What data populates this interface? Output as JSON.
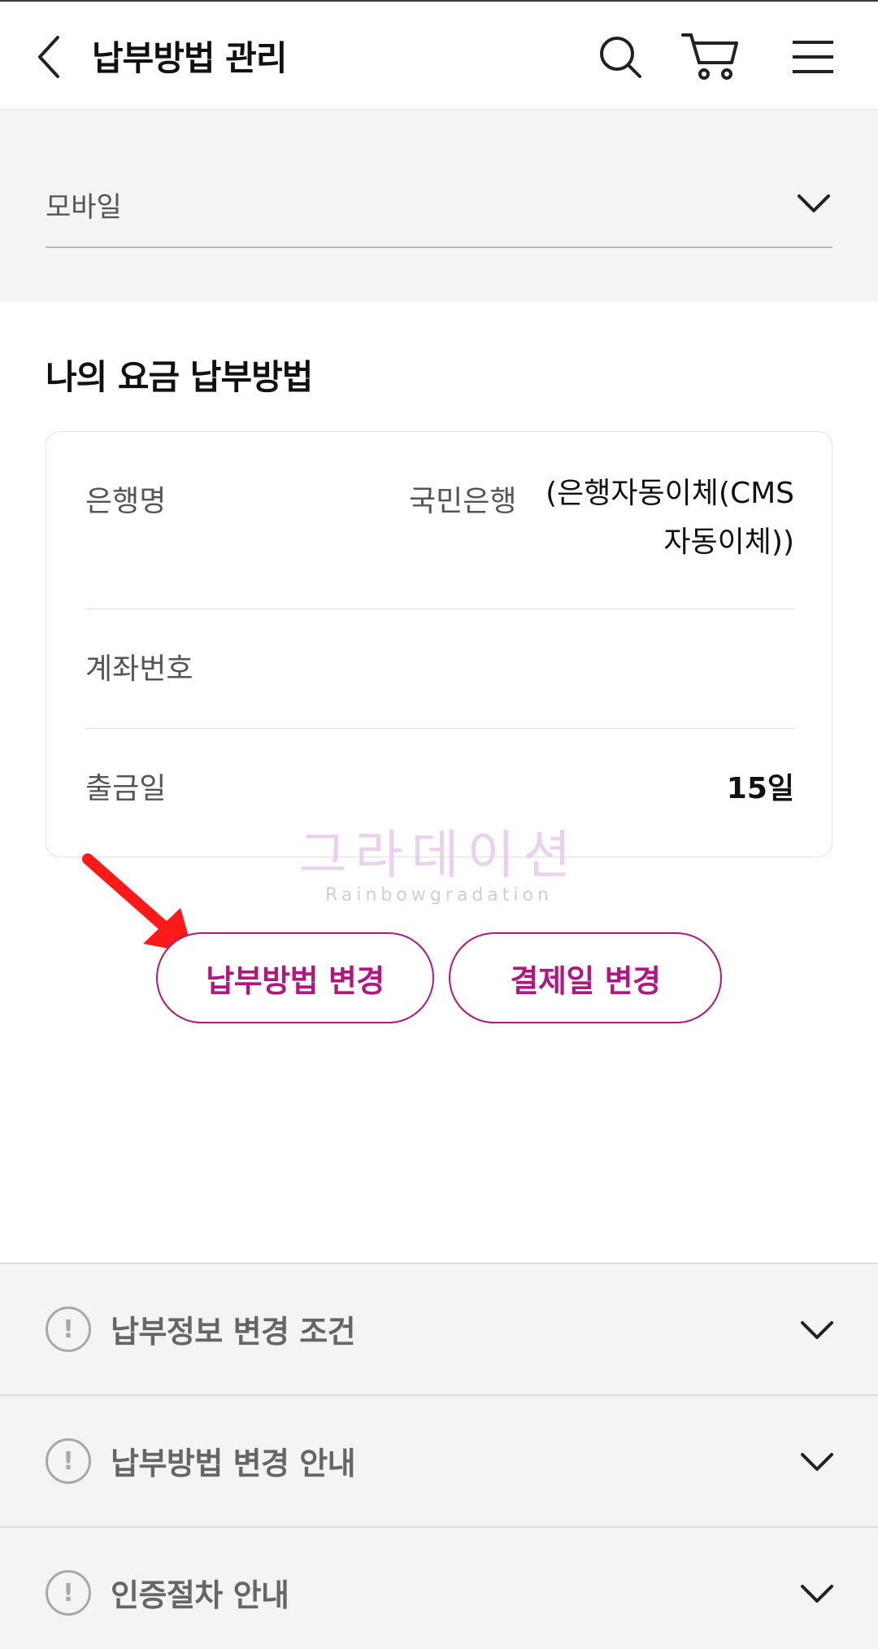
{
  "header": {
    "title": "납부방법 관리",
    "icons": [
      "back-icon",
      "search-icon",
      "cart-icon",
      "menu-icon"
    ]
  },
  "line_select": {
    "selected": "모바일"
  },
  "payment_method": {
    "section_title": "나의 요금 납부방법",
    "rows": [
      {
        "label": "은행명",
        "bank": "국민은행",
        "type": "(은행자동이체(CMS 자동이체))"
      },
      {
        "label": "계좌번호",
        "value": ""
      },
      {
        "label": "출금일",
        "value": "15일"
      }
    ]
  },
  "watermark": {
    "main": "그라데이션",
    "sub": "Rainbowgradation"
  },
  "buttons": {
    "change_method": "납부방법 변경",
    "change_date": "결제일 변경"
  },
  "accordions": [
    {
      "label": "납부정보 변경 조건"
    },
    {
      "label": "납부방법 변경 안내"
    },
    {
      "label": "인증절차 안내"
    }
  ],
  "colors": {
    "accent": "#b0177f",
    "arrow": "#ff1a1a",
    "accordion_bg": "#f4f4f4"
  }
}
